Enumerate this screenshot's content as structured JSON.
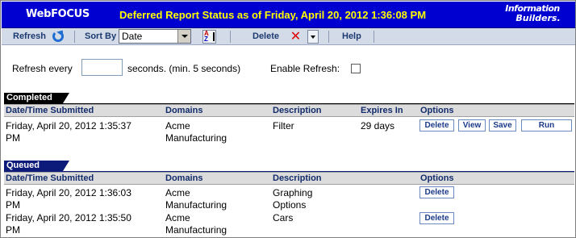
{
  "banner": {
    "product_logo": "WebFOCUS",
    "title": "Deferred Report Status as of Friday, April 20, 2012 1:36:08 PM",
    "company_logo_line1": "Information",
    "company_logo_line2": "Builders."
  },
  "toolbar": {
    "refresh_label": "Refresh",
    "sort_by_label": "Sort By",
    "sort_value": "Date",
    "delete_label": "Delete",
    "help_label": "Help"
  },
  "refresh": {
    "every_label": "Refresh every",
    "interval_value": "",
    "seconds_label": "seconds. (min. 5 seconds)",
    "enable_label": "Enable Refresh:",
    "enable_checked": false
  },
  "completed": {
    "section_label": "Completed",
    "headers": {
      "submitted": "Date/Time Submitted",
      "domains": "Domains",
      "description": "Description",
      "expires": "Expires In",
      "options": "Options"
    },
    "rows": [
      {
        "submitted_line1": "Friday, April 20, 2012 1:35:37",
        "submitted_line2": "PM",
        "domain_line1": "Acme",
        "domain_line2": "Manufacturing",
        "description": "Filter",
        "expires": "29 days",
        "actions": {
          "delete": "Delete",
          "view": "View",
          "save": "Save",
          "run": "Run"
        }
      }
    ]
  },
  "queued": {
    "section_label": "Queued",
    "headers": {
      "submitted": "Date/Time Submitted",
      "domains": "Domains",
      "description": "Description",
      "options": "Options"
    },
    "rows": [
      {
        "submitted_line1": "Friday, April 20, 2012 1:36:03",
        "submitted_line2": "PM",
        "domain_line1": "Acme",
        "domain_line2": "Manufacturing",
        "description_line1": "Graphing",
        "description_line2": "Options",
        "delete": "Delete"
      },
      {
        "submitted_line1": "Friday, April 20, 2012 1:35:50",
        "submitted_line2": "PM",
        "domain_line1": "Acme",
        "domain_line2": "Manufacturing",
        "description_line1": "Cars",
        "description_line2": "",
        "delete": "Delete"
      }
    ]
  },
  "colors": {
    "banner_bg": "#0000d0",
    "banner_title": "#ffff00",
    "toolbar_bg": "#d4dbe8",
    "queued_tab": "#0c1a7a",
    "button_text": "#1c3a8a"
  }
}
